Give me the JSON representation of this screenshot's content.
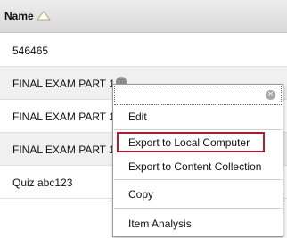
{
  "table": {
    "header": {
      "name_label": "Name",
      "sort_icon": "sort-ascending-icon"
    },
    "rows": [
      {
        "name": "546465"
      },
      {
        "name": "FINAL EXAM PART 1"
      },
      {
        "name": "FINAL EXAM PART 1("
      },
      {
        "name": "FINAL EXAM PART 1("
      },
      {
        "name": "Quiz abc123"
      }
    ]
  },
  "context_menu": {
    "close_icon": "close-icon",
    "items": [
      {
        "label": "Edit"
      },
      {
        "label": "Export to Local Computer",
        "highlighted": true
      },
      {
        "label": "Export to Content Collection"
      },
      {
        "label": "Copy"
      },
      {
        "label": "Item Analysis"
      }
    ],
    "highlight_color": "#b01c2e"
  }
}
